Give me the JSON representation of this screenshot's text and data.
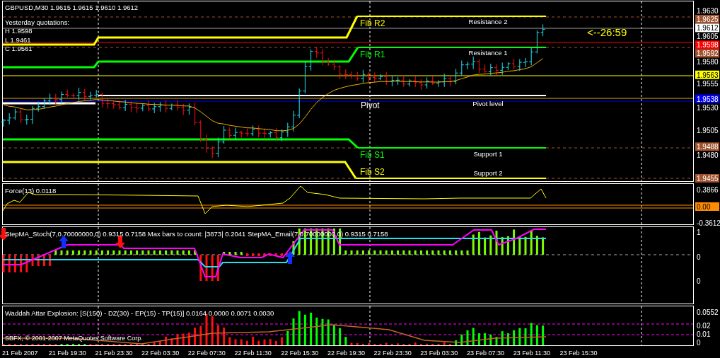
{
  "chart": {
    "title": "GBPUSD,M30 1.9615 1.9615 1.9610 1.9612",
    "yesterday": {
      "heading": "Yesterday quotations:",
      "lines": [
        "H 1.9598",
        "L 1.9461",
        "C 1.9561"
      ]
    },
    "levels": [
      {
        "label": "Fib R2",
        "name": "Resistance 2",
        "color": "#ffff00"
      },
      {
        "label": "Fib R1",
        "name": "Resistance 1",
        "color": "#00ff00"
      },
      {
        "label": "Pivot",
        "name": "Pivot level",
        "color": "#ffffff"
      },
      {
        "label": "Fib S1",
        "name": "Support 1",
        "color": "#00ff00"
      },
      {
        "label": "Fib S2",
        "name": "Support 2",
        "color": "#ffff00"
      }
    ],
    "countdown": "<--26:59",
    "price_axis": [
      {
        "text": "1.9630",
        "kind": "tick"
      },
      {
        "text": "1.9625",
        "kind": "badge",
        "color": "#a0522d"
      },
      {
        "text": "1.9612",
        "kind": "badge",
        "color": "#ffffff"
      },
      {
        "text": "1.9605",
        "kind": "tick"
      },
      {
        "text": "1.9598",
        "kind": "badge",
        "color": "#ff0000"
      },
      {
        "text": "1.9592",
        "kind": "badge",
        "color": "#a0522d"
      },
      {
        "text": "1.9580",
        "kind": "tick"
      },
      {
        "text": "1.9563",
        "kind": "badge",
        "color": "#ffff00"
      },
      {
        "text": "1.9555",
        "kind": "tick"
      },
      {
        "text": "1.9538",
        "kind": "badge",
        "color": "#0000ff"
      },
      {
        "text": "1.9530",
        "kind": "tick"
      },
      {
        "text": "1.9505",
        "kind": "tick"
      },
      {
        "text": "1.9488",
        "kind": "badge",
        "color": "#a0522d"
      },
      {
        "text": "1.9480",
        "kind": "tick"
      },
      {
        "text": "1.9455",
        "kind": "badge",
        "color": "#a0522d"
      }
    ]
  },
  "panes": [
    {
      "kind": "force",
      "title": "Force(13) 0.0118",
      "axis": [
        {
          "text": "0.3866",
          "kind": "tick"
        },
        {
          "text": "0.00",
          "kind": "badge",
          "color": "#ff8c00"
        },
        {
          "text": "-0.3612",
          "kind": "tick"
        }
      ]
    },
    {
      "kind": "stoch",
      "title": "StepMA_Stoch(7,0.70000000,0) 0.9315 0.7158  Max bars to count: |3873|  0.2041  StepMA_Email(7,0.70000000,0) 0.9315 0.7158",
      "axis": [
        {
          "text": "1",
          "kind": "tick"
        },
        {
          "text": "0",
          "kind": "tick"
        },
        {
          "text": "0",
          "kind": "tick"
        }
      ]
    },
    {
      "kind": "waddah",
      "title": "Waddah Attar Explosion: [S(150) - DZ(30) - EP(15) - TP(15)] 0.0164 0.0000 0.0071 0.0030",
      "copyright": "SBFX, © 2001-2007 MetaQuotes Software Corp.",
      "axis": [
        {
          "text": "0.0552",
          "kind": "tick"
        },
        {
          "text": "0.02",
          "kind": "tick"
        },
        {
          "text": "0.01",
          "kind": "tick"
        },
        {
          "text": "0",
          "kind": "tick"
        }
      ]
    }
  ],
  "time_axis": [
    "21 Feb 2007",
    "21 Feb 19:30",
    "21 Feb 23:30",
    "22 Feb 03:30",
    "22 Feb 07:30",
    "22 Feb 11:30",
    "22 Feb 15:30",
    "22 Feb 19:30",
    "22 Feb 23:30",
    "23 Feb 03:30",
    "23 Feb 07:30",
    "23 Feb 11:30",
    "23 Feb 15:30"
  ]
}
